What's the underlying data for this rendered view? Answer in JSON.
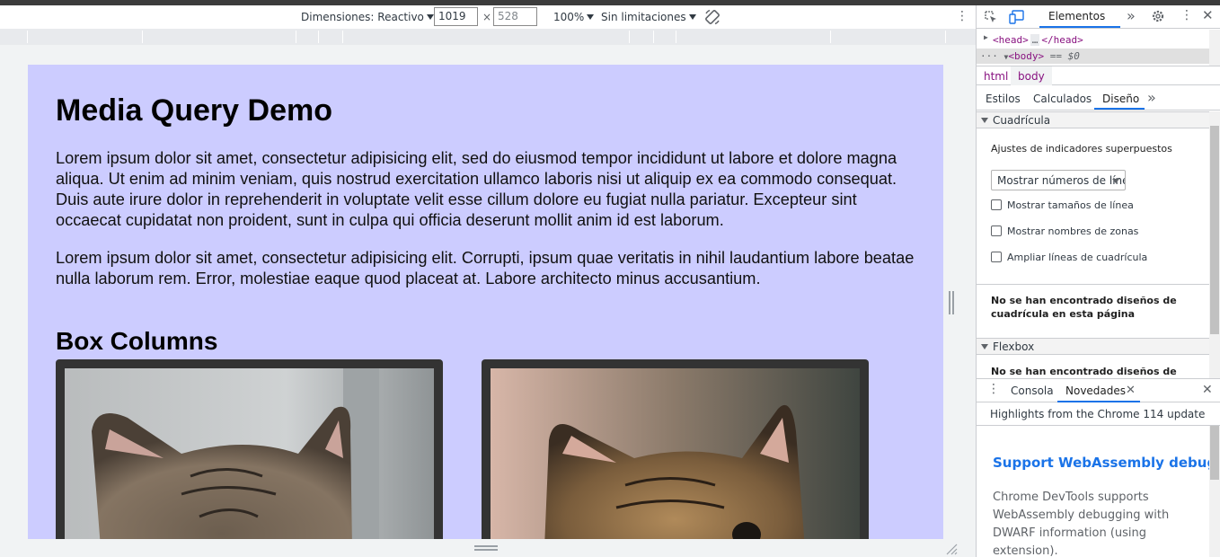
{
  "device_toolbar": {
    "dimensions_label": "Dimensiones: Reactivo",
    "width": "1019",
    "times": "×",
    "height": "528",
    "zoom": "100%",
    "throttle": "Sin limitaciones"
  },
  "page": {
    "heading": "Media Query Demo",
    "paragraph1": "Lorem ipsum dolor sit amet, consectetur adipisicing elit, sed do eiusmod tempor incididunt ut labore et dolore magna aliqua. Ut enim ad minim veniam, quis nostrud exercitation ullamco laboris nisi ut aliquip ex ea commodo consequat. Duis aute irure dolor in reprehenderit in voluptate velit esse cillum dolore eu fugiat nulla pariatur. Excepteur sint occaecat cupidatat non proident, sunt in culpa qui officia deserunt mollit anim id est laborum.",
    "paragraph2": "Lorem ipsum dolor sit amet, consectetur adipisicing elit. Corrupti, ipsum quae veritatis in nihil laudantium labore beatae nulla laborum rem. Error, molestiae eaque quod placeat at. Labore architecto minus accusantium.",
    "subheading": "Box Columns",
    "background_color": "#ccccff"
  },
  "devtools": {
    "main_tab": "Elementos",
    "dom": {
      "head_open": "<head>",
      "ellipsis": "…",
      "head_close": "</head>",
      "body_dots": "···",
      "body_tag": "<body>",
      "body_ref": "== $0"
    },
    "breadcrumb": [
      "html",
      "body"
    ],
    "subtabs": [
      "Estilos",
      "Calculados",
      "Diseño"
    ],
    "layout": {
      "grid_section": "Cuadrícula",
      "overlay_heading": "Ajustes de indicadores superpuestos",
      "select_value": "Mostrar números de línea",
      "checkboxes": [
        "Mostrar tamaños de línea",
        "Mostrar nombres de zonas",
        "Ampliar líneas de cuadrícula"
      ],
      "no_grid_msg": "No se han encontrado diseños de cuadrícula en esta página",
      "flex_section": "Flexbox",
      "no_flex_msg": "No se han encontrado diseños de"
    },
    "drawer": {
      "tabs": [
        "Consola",
        "Novedades"
      ],
      "highlights": "Highlights from the Chrome 114 update",
      "title": "Support WebAssembly debugging",
      "description": "Chrome DevTools supports WebAssembly debugging with DWARF information (using extension)."
    },
    "accent_color": "#1a73e8"
  }
}
